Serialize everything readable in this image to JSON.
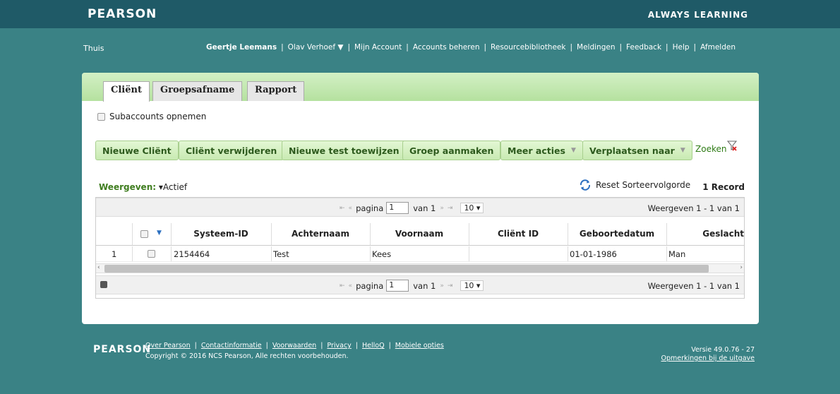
{
  "header": {
    "brand": "PEARSON",
    "tagline": "ALWAYS LEARNING"
  },
  "nav": {
    "home": "Thuis",
    "user": "Geertje Leemans",
    "items": [
      "Olav Verhoef ▼",
      "Mijn Account",
      "Accounts beheren",
      "Resourcebibliotheek",
      "Meldingen",
      "Feedback",
      "Help",
      "Afmelden"
    ]
  },
  "tabs": [
    "Cliënt",
    "Groepsafname",
    "Rapport"
  ],
  "options": {
    "subaccounts": "Subaccounts opnemen"
  },
  "toolbar": {
    "new_client": "Nieuwe Cliënt",
    "delete_client": "Cliënt verwijderen",
    "assign_test": "Nieuwe test toewijzen",
    "create_group": "Groep aanmaken",
    "more_actions": "Meer acties",
    "move_to": "Verplaatsen naar",
    "search": "Zoeken"
  },
  "filter": {
    "label": "Weergeven:",
    "value": "▾Actief"
  },
  "reset_sort": "Reset Sorteervolgorde",
  "record_count": "1 Record",
  "pager": {
    "page_label": "pagina",
    "page_value": "1",
    "of_label": "van 1",
    "per_page": "10",
    "view_text": "Weergeven 1 - 1 van 1"
  },
  "table": {
    "columns": [
      "Systeem-ID",
      "Achternaam",
      "Voornaam",
      "Cliënt ID",
      "Geboortedatum",
      "Geslacht"
    ],
    "rows": [
      {
        "index": "1",
        "systeem_id": "2154464",
        "achternaam": "Test",
        "voornaam": "Kees",
        "client_id": "",
        "geboortedatum": "01-01-1986",
        "geslacht": "Man"
      }
    ]
  },
  "footer": {
    "brand": "PEARSON",
    "links": [
      "Over Pearson",
      "Contactinformatie",
      "Voorwaarden",
      "Privacy",
      "HelloQ",
      "Mobiele opties"
    ],
    "copyright": "Copyright © 2016 NCS Pearson, Alle rechten voorbehouden.",
    "version": "Versie 49.0.76 - 27",
    "release_notes": "Opmerkingen bij de uitgave"
  }
}
